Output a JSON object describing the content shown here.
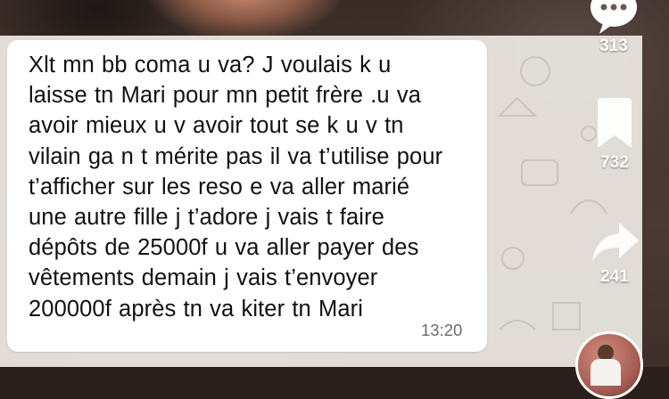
{
  "message": {
    "lines": [
      "Xlt mn bb coma u va? J voulais k u",
      "laisse tn Mari pour mn petit frère .u va",
      "avoir mieux u v avoir tout se k u v tn",
      "vilain ga n t mérite pas il va t’utilise pour",
      "t’afficher sur les reso e va aller marié",
      "une autre fille j t’adore j vais t faire",
      "dépôts de 25000f u va aller payer des",
      "vêtements demain j vais t’envoyer",
      "200000f après tn va kiter tn Mari"
    ],
    "time": "13:20"
  },
  "actions": {
    "comments": {
      "icon": "comment-dots-icon",
      "count": "313"
    },
    "favorites": {
      "icon": "bookmark-icon",
      "count": "732"
    },
    "shares": {
      "icon": "share-arrow-icon",
      "count": "241"
    }
  },
  "colors": {
    "bubble": "#ffffff",
    "chat_background": "#e6e2dc",
    "time_text": "#6b6b6b",
    "rail_icon": "#ffffff"
  }
}
